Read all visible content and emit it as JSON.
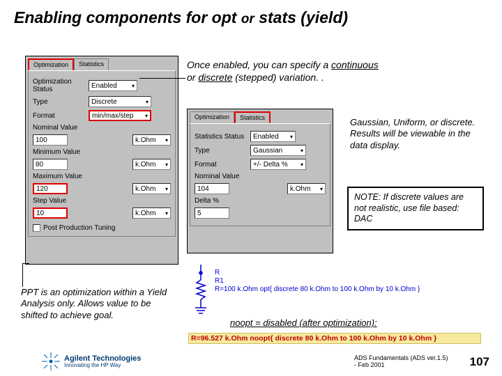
{
  "title": {
    "a": "Enabling components for opt",
    "or": "or",
    "b": "stats (yield)"
  },
  "subtitle": {
    "t1": "Once enabled, you can specify a ",
    "u1": "continuous",
    "t2": " or ",
    "u2": "discrete",
    "t3": " (stepped) variation. ."
  },
  "left": {
    "tabs": [
      "Optimization",
      "Statistics"
    ],
    "statusLabel": "Optimization Status",
    "status": "Enabled",
    "typeLabel": "Type",
    "type": "Discrete",
    "formatLabel": "Format",
    "format": "min/max/step",
    "nomLabel": "Nominal Value",
    "fields": [
      {
        "lbl": "",
        "val": "100",
        "unit": "k.Ohm"
      },
      {
        "lbl": "Minimum Value",
        "val": "80",
        "unit": "k.Ohm"
      },
      {
        "lbl": "Maximum Value",
        "val": "120",
        "unit": "k.Ohm"
      },
      {
        "lbl": "Step Value",
        "val": "10",
        "unit": "k.Ohm"
      }
    ],
    "pptLabel": "Post Production Tuning"
  },
  "right": {
    "tabs": [
      "Optimization",
      "Statistics"
    ],
    "statusLabel": "Statistics Status",
    "status": "Enabled",
    "typeLabel": "Type",
    "type": "Gaussian",
    "formatLabel": "Format",
    "format": "+/- Delta %",
    "nomLabel": "Nominal Value",
    "nomVal": "104",
    "nomUnit": "k.Ohm",
    "deltaLabel": "Delta %",
    "deltaVal": "5"
  },
  "anno1": "Gaussian, Uniform, or discrete. Results will be viewable in the data display.",
  "note": "NOTE: If discrete values are not realistic, use file based: DAC",
  "annoPPT": "PPT is an optimization within a Yield Analysis only. Allows value to be shifted to achieve goal.",
  "schem": {
    "l1": "R",
    "l2": "R1",
    "l3": "R=100 k.Ohm opt{ discrete 80 k.Ohm to 100 k.Ohm by 10 k.Ohm }"
  },
  "noopt": "noopt = disabled (after optimization):",
  "redbar": "R=96.527 k.Ohm noopt{ discrete 80 k.Ohm to 100 k.Ohm by 10 k.Ohm }",
  "footer": {
    "company": "Agilent Technologies",
    "tagline": "Innovating the HP Way",
    "attrib": "ADS Fundamentals (ADS ver.1.5) - Feb 2001",
    "page": "107"
  }
}
